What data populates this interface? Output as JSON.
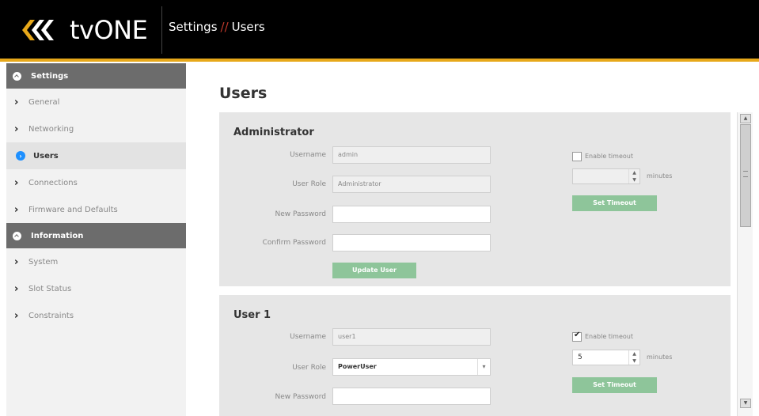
{
  "header": {
    "logo_text": "tvONE",
    "breadcrumb_section": "Settings",
    "breadcrumb_sep": "//",
    "breadcrumb_page": "Users",
    "accent_color": "#e7a81a"
  },
  "sidebar": {
    "groups": [
      {
        "label": "Settings",
        "items": [
          {
            "label": "General"
          },
          {
            "label": "Networking"
          },
          {
            "label": "Users",
            "active": true
          },
          {
            "label": "Connections"
          },
          {
            "label": "Firmware and Defaults"
          }
        ]
      },
      {
        "label": "Information",
        "items": [
          {
            "label": "System"
          },
          {
            "label": "Slot Status"
          },
          {
            "label": "Constraints"
          }
        ]
      }
    ]
  },
  "main": {
    "title": "Users",
    "panels": [
      {
        "title": "Administrator",
        "username_label": "Username",
        "username": "admin",
        "role_label": "User Role",
        "role": "Administrator",
        "new_password_label": "New Password",
        "confirm_password_label": "Confirm Password",
        "update_button": "Update User",
        "enable_timeout_label": "Enable timeout",
        "enable_timeout": false,
        "timeout_value": "",
        "minutes_label": "minutes",
        "set_timeout_button": "Set Timeout"
      },
      {
        "title": "User 1",
        "username_label": "Username",
        "username": "user1",
        "role_label": "User Role",
        "role": "PowerUser",
        "new_password_label": "New Password",
        "enable_timeout_label": "Enable timeout",
        "enable_timeout": true,
        "timeout_value": "5",
        "minutes_label": "minutes",
        "set_timeout_button": "Set Timeout"
      }
    ]
  },
  "colors": {
    "button_green": "#8ec59a",
    "active_blue": "#1e90ff",
    "group_gray": "#6c6c6c"
  }
}
